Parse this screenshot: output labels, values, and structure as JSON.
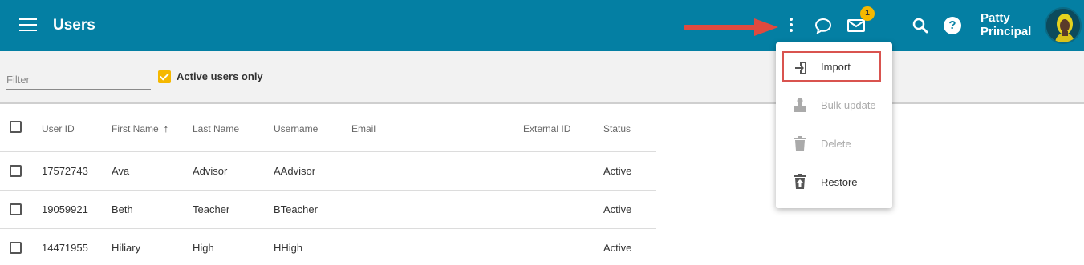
{
  "header": {
    "title": "Users",
    "notification_count": "1",
    "user_name": "Patty Principal",
    "help_label": "?"
  },
  "filterbar": {
    "filter_placeholder": "Filter",
    "active_only_label": "Active users only",
    "active_only_checked": true
  },
  "table": {
    "columns": [
      "User ID",
      "First Name",
      "Last Name",
      "Username",
      "Email",
      "External ID",
      "Status"
    ],
    "sort_indicator": "↑",
    "rows": [
      {
        "user_id": "17572743",
        "first_name": "Ava",
        "last_name": "Advisor",
        "username": "AAdvisor",
        "email": "",
        "external_id": "",
        "status": "Active"
      },
      {
        "user_id": "19059921",
        "first_name": "Beth",
        "last_name": "Teacher",
        "username": "BTeacher",
        "email": "",
        "external_id": "",
        "status": "Active"
      },
      {
        "user_id": "14471955",
        "first_name": "Hiliary",
        "last_name": "High",
        "username": "HHigh",
        "email": "",
        "external_id": "",
        "status": "Active"
      }
    ]
  },
  "menu": {
    "items": [
      {
        "label": "Import",
        "icon": "import-icon",
        "enabled": true
      },
      {
        "label": "Bulk update",
        "icon": "stamp-icon",
        "enabled": false
      },
      {
        "label": "Delete",
        "icon": "trash-icon",
        "enabled": false
      },
      {
        "label": "Restore",
        "icon": "restore-icon",
        "enabled": true
      }
    ]
  },
  "colors": {
    "header_bg": "#047fa3",
    "accent": "#f5b800",
    "link": "#2b73b5",
    "highlight": "#d9534f",
    "annotation_arrow": "#e04a3f"
  }
}
